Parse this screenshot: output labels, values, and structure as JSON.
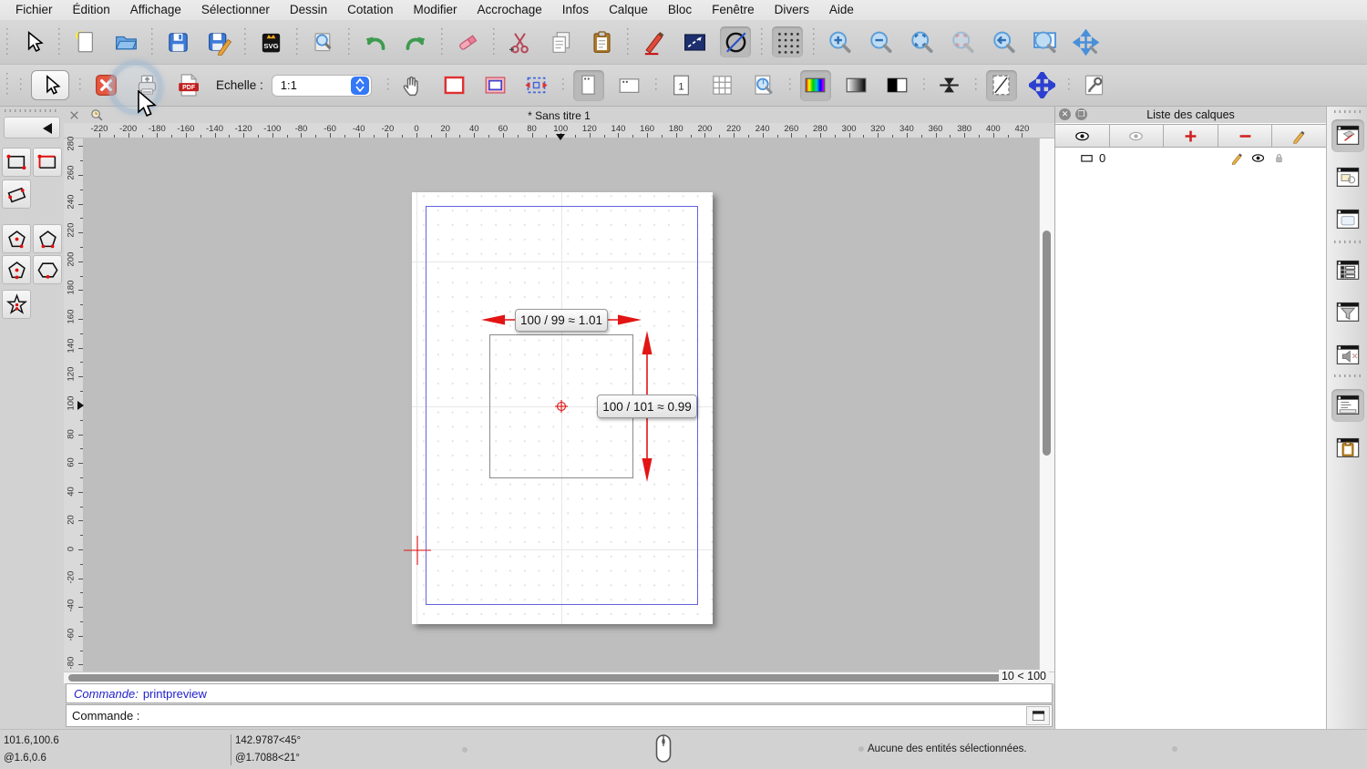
{
  "menu_bar": {
    "items": [
      "Fichier",
      "Édition",
      "Affichage",
      "Sélectionner",
      "Dessin",
      "Cotation",
      "Modifier",
      "Accrochage",
      "Infos",
      "Calque",
      "Bloc",
      "Fenêtre",
      "Divers",
      "Aide"
    ]
  },
  "toolbar_main": {
    "groups": [
      [
        {
          "icon": "select-cursor"
        }
      ],
      [
        {
          "icon": "new-document"
        },
        {
          "icon": "open-file"
        }
      ],
      [
        {
          "icon": "save"
        },
        {
          "icon": "save-as"
        }
      ],
      [
        {
          "icon": "export-svg"
        }
      ],
      [
        {
          "icon": "print-preview"
        }
      ],
      [
        {
          "icon": "undo"
        },
        {
          "icon": "redo"
        }
      ],
      [
        {
          "icon": "delete-eraser"
        }
      ],
      [
        {
          "icon": "cut"
        },
        {
          "icon": "copy"
        },
        {
          "icon": "paste"
        }
      ],
      [
        {
          "icon": "pen-edit"
        },
        {
          "icon": "line-attributes"
        },
        {
          "icon": "circle-line",
          "state": "pressed"
        }
      ],
      [
        {
          "icon": "grid-dots",
          "state": "pressed"
        }
      ],
      [
        {
          "icon": "zoom-in"
        },
        {
          "icon": "zoom-out"
        },
        {
          "icon": "zoom-auto"
        },
        {
          "icon": "zoom-selected",
          "state": "disabled"
        },
        {
          "icon": "zoom-previous"
        },
        {
          "icon": "zoom-window"
        },
        {
          "icon": "zoom-pan"
        }
      ]
    ]
  },
  "toolbar_print": {
    "left_groups": [
      [
        {
          "icon": "select-cursor2",
          "framed": true
        }
      ],
      [
        {
          "icon": "close-preview"
        },
        {
          "icon": "printer"
        },
        {
          "icon": "export-pdf"
        }
      ]
    ],
    "scale_label": "Echelle :",
    "scale_value": "1:1",
    "right_groups": [
      [
        {
          "icon": "pan-hand"
        },
        {
          "icon": "paper-border"
        },
        {
          "icon": "paper-margins"
        },
        {
          "icon": "fit-paper"
        }
      ],
      [
        {
          "icon": "orientation-portrait",
          "state": "pressed"
        },
        {
          "icon": "orientation-landscape"
        }
      ],
      [
        {
          "icon": "single-page"
        },
        {
          "icon": "multi-pages"
        },
        {
          "icon": "zoom-page"
        }
      ],
      [
        {
          "icon": "color-mode",
          "state": "pressed"
        },
        {
          "icon": "grayscale-mode"
        },
        {
          "icon": "blackwhite-mode"
        }
      ],
      [
        {
          "icon": "center-plot"
        }
      ],
      [
        {
          "icon": "fixed-paper",
          "state": "pressed"
        },
        {
          "icon": "move-paper-cross"
        }
      ],
      [
        {
          "icon": "preview-settings"
        }
      ]
    ]
  },
  "left_toolbar": {
    "tools": [
      "rect-2-corners",
      "rect-corner-size",
      "rect-rotated",
      "polygon-center-vertex",
      "polygon-2-vertices",
      "polygon-center-side",
      "polygon-inscribed",
      "star-shape"
    ]
  },
  "tab_bar": {
    "title": "* Sans titre 1"
  },
  "rulers": {
    "h_ticks": [
      -220,
      -200,
      -180,
      -160,
      -140,
      -120,
      -100,
      -80,
      -60,
      -40,
      -20,
      0,
      20,
      40,
      60,
      80,
      100,
      120,
      140,
      160,
      180,
      200,
      220,
      240,
      260,
      280,
      300,
      320,
      340,
      360,
      380,
      400,
      420
    ],
    "v_ticks": [
      280,
      260,
      240,
      220,
      200,
      180,
      160,
      140,
      120,
      100,
      80,
      60,
      40,
      20,
      0,
      -20,
      -40,
      -60,
      -80
    ],
    "h_marker": 100,
    "v_marker": 100
  },
  "canvas": {
    "dim_h_label": "100 / 99 ≈ 1.01",
    "dim_v_label": "100 / 101 ≈ 0.99",
    "grid_status": "10 < 100"
  },
  "layers_panel": {
    "title": "Liste des calques",
    "toolbar": [
      {
        "name": "defreeze-all-layers",
        "icon": "eye"
      },
      {
        "name": "freeze-all-layers",
        "icon": "eye-gray"
      },
      {
        "name": "add-layer",
        "icon": "plus-red"
      },
      {
        "name": "remove-layer",
        "icon": "minus-red"
      },
      {
        "name": "edit-layer",
        "icon": "pencil"
      }
    ],
    "layers": [
      {
        "name": "0"
      }
    ]
  },
  "dock": {
    "items": [
      {
        "name": "layer-list-dock",
        "active": true
      },
      {
        "name": "block-list-dock",
        "active": false
      },
      {
        "name": "library-browser-dock",
        "active": false
      },
      {
        "name": "command-options-dock",
        "active": false
      },
      {
        "name": "selection-filter-dock",
        "active": false
      },
      {
        "name": "plugins-dock",
        "active": false
      },
      {
        "name": "command-line-dock",
        "active": true
      },
      {
        "name": "clipboard-dock",
        "active": false
      }
    ]
  },
  "command": {
    "history_label": "Commande:",
    "history_value": "printpreview",
    "prompt": "Commande :"
  },
  "status_bar": {
    "abs_coord": "101.6,100.6",
    "rel_coord": "@1.6,0.6",
    "polar_abs": "142.9787<45°",
    "polar_rel": "@1.7088<21°",
    "selection": "Aucune des entités sélectionnées."
  },
  "colors": {
    "accent_red": "#E31414",
    "margin_blue": "#6464DA",
    "command_blue": "#2020CC"
  }
}
